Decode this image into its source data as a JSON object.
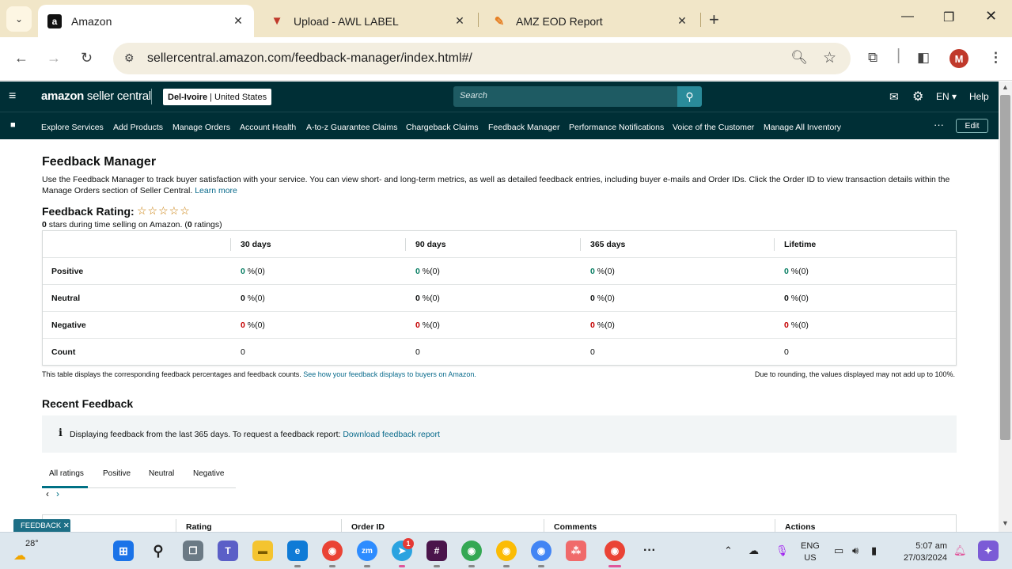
{
  "browser": {
    "tabs": [
      {
        "title": "Amazon",
        "active": true,
        "favicon": "amazon-a-icon"
      },
      {
        "title": "Upload - AWL LABEL",
        "active": false,
        "favicon": "awl-label-icon"
      },
      {
        "title": "AMZ EOD Report",
        "active": false,
        "favicon": "pencil-report-icon"
      }
    ],
    "url": "sellercentral.amazon.com/feedback-manager/index.html#/",
    "profile_initial": "M"
  },
  "header": {
    "logo_strong": "amazon",
    "logo_rest": " seller central",
    "store_name": "Del-Ivoire",
    "store_region": "| United States",
    "search_placeholder": "Search",
    "language": "EN",
    "help": "Help"
  },
  "nav": {
    "items": [
      "Explore Services",
      "Add Products",
      "Manage Orders",
      "Account Health",
      "A-to-z Guarantee Claims",
      "Chargeback Claims",
      "Feedback Manager",
      "Performance Notifications",
      "Voice of the Customer",
      "Manage All Inventory"
    ],
    "more": "···",
    "edit": "Edit"
  },
  "page": {
    "title": "Feedback Manager",
    "intro": "Use the Feedback Manager to track buyer satisfaction with your service. You can view short- and long-term metrics, as well as detailed feedback entries, including buyer e-mails and Order IDs. Click the Order ID to view transaction details within the Manage Orders section of Seller Central.",
    "learn_more": "Learn more",
    "rating_label": "Feedback Rating:",
    "stars": "☆☆☆☆☆",
    "rating_sub_stars": "0",
    "rating_sub_mid": " stars during time selling on Amazon. (",
    "rating_sub_count": "0",
    "rating_sub_end": " ratings)"
  },
  "feedback_table": {
    "columns": [
      "30 days",
      "90 days",
      "365 days",
      "Lifetime"
    ],
    "rows": [
      {
        "label": "Positive",
        "cells": [
          {
            "num": "0",
            "rest": " %(0)"
          },
          {
            "num": "0",
            "rest": " %(0)"
          },
          {
            "num": "0",
            "rest": " %(0)"
          },
          {
            "num": "0",
            "rest": " %(0)"
          }
        ]
      },
      {
        "label": "Neutral",
        "cells": [
          {
            "num": "0",
            "rest": " %(0)"
          },
          {
            "num": "0",
            "rest": " %(0)"
          },
          {
            "num": "0",
            "rest": " %(0)"
          },
          {
            "num": "0",
            "rest": " %(0)"
          }
        ]
      },
      {
        "label": "Negative",
        "cells": [
          {
            "num": "0",
            "rest": " %(0)"
          },
          {
            "num": "0",
            "rest": " %(0)"
          },
          {
            "num": "0",
            "rest": " %(0)"
          },
          {
            "num": "0",
            "rest": " %(0)"
          }
        ]
      },
      {
        "label": "Count",
        "cells": [
          {
            "num": "",
            "rest": "0"
          },
          {
            "num": "",
            "rest": "0"
          },
          {
            "num": "",
            "rest": "0"
          },
          {
            "num": "",
            "rest": "0"
          }
        ]
      }
    ],
    "note": "This table displays the corresponding feedback percentages and feedback counts.",
    "note_link": "See how your feedback displays to buyers on Amazon.",
    "rounding_note": "Due to rounding, the values displayed may not add up to 100%."
  },
  "recent": {
    "title": "Recent Feedback",
    "info_icon": "i",
    "info_text": "Displaying feedback from the last 365 days. To request a feedback report:",
    "info_link": "Download feedback report",
    "tabs": [
      "All ratings",
      "Positive",
      "Neutral",
      "Negative"
    ],
    "list_columns": [
      ".",
      "Rating",
      "Order ID",
      "Comments",
      "Actions"
    ],
    "feedback_badge": "FEEDBACK ✕"
  },
  "taskbar": {
    "temperature": "28°",
    "lang_line1": "ENG",
    "lang_line2": "US",
    "time": "5:07 am",
    "date": "27/03/2024",
    "telegram_badge": "1"
  },
  "colors": {
    "sc_header": "#002f36",
    "positive": "#067d62",
    "negative": "#c40000",
    "link": "#0a6b8c",
    "tab_strip": "#f1e6c8"
  }
}
